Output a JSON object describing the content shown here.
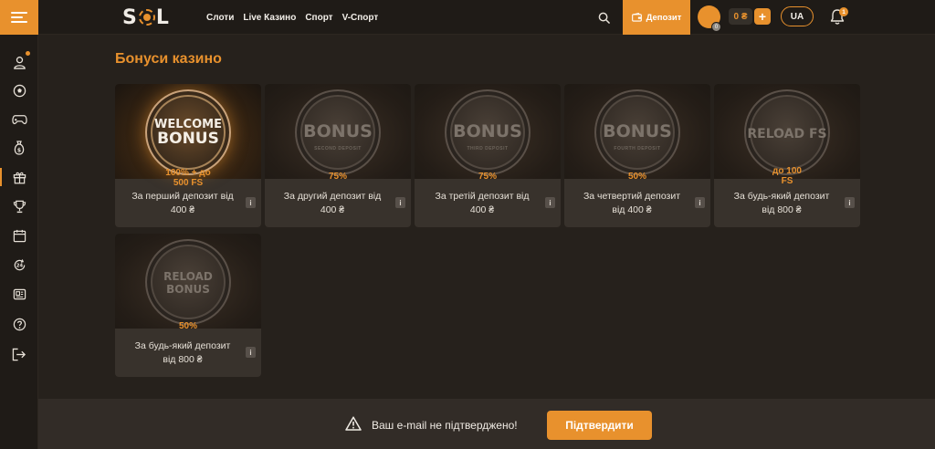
{
  "header": {
    "logo": "SOL",
    "nav": [
      "Слоти",
      "Live Казино",
      "Спорт",
      "V-Спорт"
    ],
    "deposit_label": "Депозит",
    "avatar_badge": "0",
    "balance": "0 ₴",
    "plus": "+",
    "language": "UA",
    "notifications_count": "1"
  },
  "sidebar": {
    "items": [
      "profile-icon",
      "sport-ball-icon",
      "gamepad-icon",
      "money-bag-icon",
      "gift-icon",
      "trophy-icon",
      "calendar-icon",
      "clock-24-icon",
      "ticket-icon",
      "help-icon",
      "logout-icon"
    ],
    "active_index": 4,
    "accent": "#e8912d"
  },
  "page": {
    "title": "Бонуси казино"
  },
  "bonuses": [
    {
      "art_line1": "WELCOME",
      "art_line2": "BONUS",
      "art_sub": "",
      "value_line1": "100% + до",
      "value_line2": "500 FS",
      "desc_line1": "За перший депозит від",
      "desc_line2": "400 ₴",
      "info": "i"
    },
    {
      "art_line1": "BONUS",
      "art_line2": "",
      "art_sub": "SECOND DEPOSIT",
      "value_line1": "75%",
      "value_line2": "",
      "desc_line1": "За другий депозит від",
      "desc_line2": "400 ₴",
      "info": "i"
    },
    {
      "art_line1": "BONUS",
      "art_line2": "",
      "art_sub": "THIRD DEPOSIT",
      "value_line1": "75%",
      "value_line2": "",
      "desc_line1": "За третій депозит від",
      "desc_line2": "400 ₴",
      "info": "i"
    },
    {
      "art_line1": "BONUS",
      "art_line2": "",
      "art_sub": "FOURTH DEPOSIT",
      "value_line1": "50%",
      "value_line2": "",
      "desc_line1": "За четвертий депозит",
      "desc_line2": "від 400 ₴",
      "info": "i"
    },
    {
      "art_line1": "RELOAD FS",
      "art_line2": "",
      "art_sub": "",
      "value_line1": "до 100",
      "value_line2": "FS",
      "desc_line1": "За будь-який депозит",
      "desc_line2": "від 800 ₴",
      "info": "i"
    },
    {
      "art_line1": "RELOAD",
      "art_line2": "BONUS",
      "art_sub": "",
      "value_line1": "50%",
      "value_line2": "",
      "desc_line1": "За будь-який депозит",
      "desc_line2": "від 800 ₴",
      "info": "i"
    }
  ],
  "footer": {
    "message": "Ваш e-mail не підтверджено!",
    "confirm_label": "Підтвердити"
  }
}
